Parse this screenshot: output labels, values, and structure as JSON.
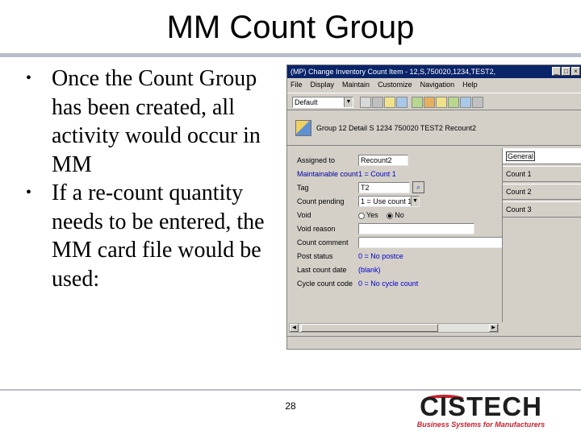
{
  "slide": {
    "title": "MM Count Group",
    "bullets": [
      "Once the Count Group has been created, all activity would occur in MM",
      "If a re-count quantity needs to be entered, the MM card file would be used:"
    ],
    "page_number": "28"
  },
  "logo": {
    "name": "CISTECH",
    "tagline": "Business Systems for Manufacturers"
  },
  "window": {
    "title": "(MP) Change Inventory Count Item - 12,S,750020,1234,TEST2,",
    "controls": {
      "minimize": "_",
      "maximize": "□",
      "close": "×"
    },
    "menu": [
      "File",
      "Display",
      "Maintain",
      "Customize",
      "Navigation",
      "Help"
    ],
    "view_select": "Default",
    "context_text": "Group  12    Detail S    1234    750020    TEST2    Recount2",
    "fields": [
      {
        "label": "Assigned to",
        "value": "Recount2",
        "kind": "input"
      },
      {
        "label": "Maintainable count",
        "value": "1 = Count 1",
        "kind": "blue"
      },
      {
        "label": "Tag",
        "value": "T2",
        "kind": "input-search"
      },
      {
        "label": "Count pending",
        "value": "1 = Use count 1",
        "kind": "select"
      },
      {
        "label": "Void",
        "yes": "Yes",
        "no": "No",
        "kind": "radio"
      },
      {
        "label": "Void reason",
        "value": "",
        "kind": "input"
      },
      {
        "label": "Count comment",
        "value": "",
        "kind": "input"
      },
      {
        "label": "Post status",
        "value": "0 = No postce",
        "kind": "blue"
      },
      {
        "label": "Last count date",
        "value": "(blank)",
        "kind": "blue"
      },
      {
        "label": "Cycle count code",
        "value": "0 = No cycle count",
        "kind": "blue"
      }
    ],
    "side_tabs": [
      "General",
      "Count 1",
      "Count 2",
      "Count 3"
    ]
  },
  "colors": {
    "title_bar": "#0a246a",
    "rule": "#b7bec9",
    "logo_red": "#c8202f"
  }
}
